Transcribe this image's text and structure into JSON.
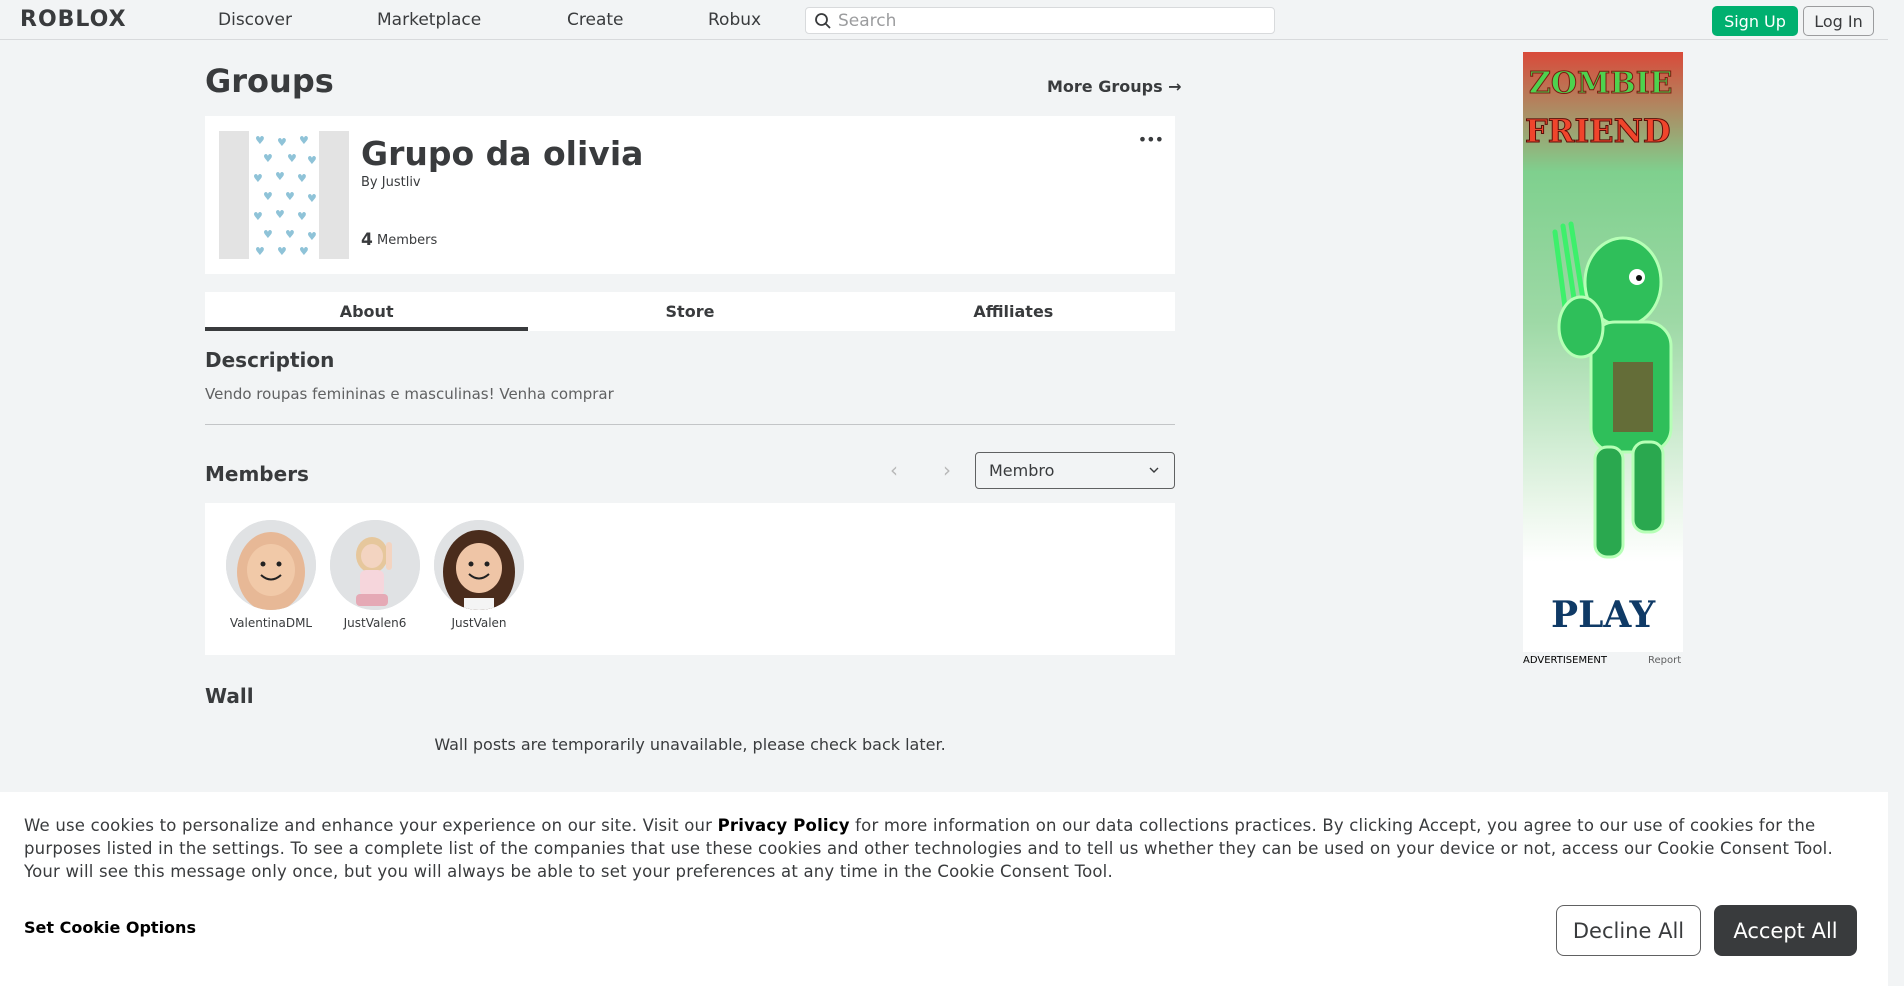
{
  "nav": {
    "logo": "ROBLOX",
    "links": [
      "Discover",
      "Marketplace",
      "Create",
      "Robux"
    ],
    "search_placeholder": "Search",
    "signup_label": "Sign Up",
    "login_label": "Log In"
  },
  "page": {
    "title": "Groups",
    "more_groups": "More Groups →"
  },
  "group": {
    "name": "Grupo da olivia",
    "by_label": "By",
    "owner": "Justliv",
    "member_count": "4",
    "members_label": "Members",
    "more_options": "•••"
  },
  "tabs": [
    "About",
    "Store",
    "Affiliates"
  ],
  "about": {
    "description_title": "Description",
    "description_text": "Vendo roupas femininas e masculinas! Venha comprar",
    "members_title": "Members",
    "role_selected": "Membro",
    "members": [
      {
        "name": "ValentinaDML",
        "skin": "#f1c9a8",
        "hair": "#e7b896"
      },
      {
        "name": "JustValen6",
        "skin": "#f3d4c1",
        "hair": "#e6c79c"
      },
      {
        "name": "JustValen",
        "skin": "#efc5a6",
        "hair": "#4a2c1c"
      }
    ],
    "wall_title": "Wall",
    "wall_message": "Wall posts are temporarily unavailable, please check back later."
  },
  "ad": {
    "line1": "ZOMBIE",
    "line2": "FRIEND",
    "cta": "PLAY",
    "label": "ADVERTISEMENT",
    "report": "Report"
  },
  "cookie": {
    "text_before": "We use cookies to personalize and enhance your experience on our site. Visit our ",
    "privacy_link": "Privacy Policy",
    "text_after": " for more information on our data collections practices. By clicking Accept, you agree to our use of cookies for the purposes listed in the settings. To see a complete list of the companies that use these cookies and other technologies and to tell us whether they can be used on your device or not, access our Cookie Consent Tool. Your will see this message only once, but you will always be able to set your preferences at any time in the Cookie Consent Tool.",
    "set_options": "Set Cookie Options",
    "decline": "Decline All",
    "accept": "Accept All"
  }
}
